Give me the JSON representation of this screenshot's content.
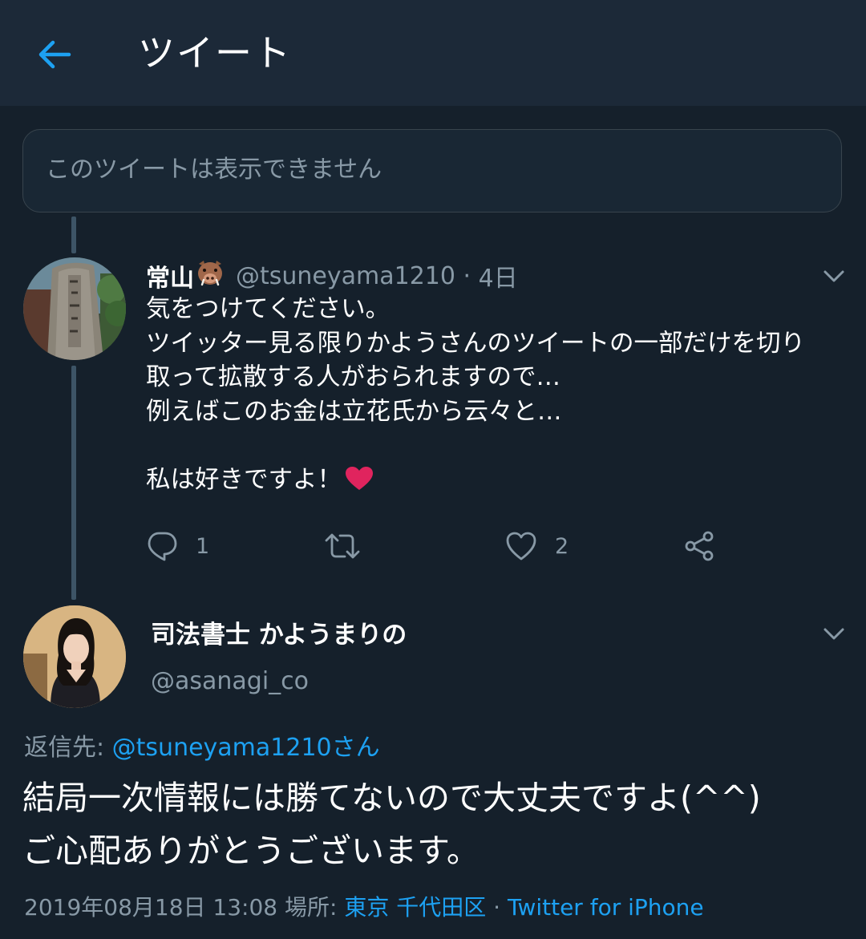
{
  "header": {
    "title": "ツイート",
    "back_icon": "back-arrow-icon",
    "accent": "#1da1f2"
  },
  "unavailable": {
    "text": "このツイートは表示できません"
  },
  "reply_tweet": {
    "display_name": "常山",
    "emoji": "boar-face",
    "handle": "@tsuneyama1210",
    "separator": "·",
    "age": "4日",
    "lines": [
      "気をつけてください。",
      "ツイッター見る限りかようさんのツイートの一部だけを切り",
      "取って拡散する人がおられますので…",
      "例えばこのお金は立花氏から云々と…",
      "",
      "私は好きですよ！"
    ],
    "actions": {
      "reply_count": "1",
      "retweet_count": "",
      "like_count": "2"
    }
  },
  "main_tweet": {
    "display_name": "司法書士 かようまりの",
    "handle": "@asanagi_co",
    "replying_prefix": "返信先: ",
    "replying_to": "@tsuneyama1210さん",
    "lines": [
      "結局一次情報には勝てないので大丈夫ですよ(^^)",
      "ご心配ありがとうございます。"
    ],
    "date": "2019年08月18日 13:08",
    "place_prefix": "場所: ",
    "place": "東京 千代田区",
    "source_separator": " · ",
    "source": "Twitter for iPhone"
  },
  "colors": {
    "background": "#15202b",
    "header_bg": "#1c2938",
    "secondary_text": "#8899a6",
    "link": "#1da1f2",
    "heart": "#e0245e"
  }
}
